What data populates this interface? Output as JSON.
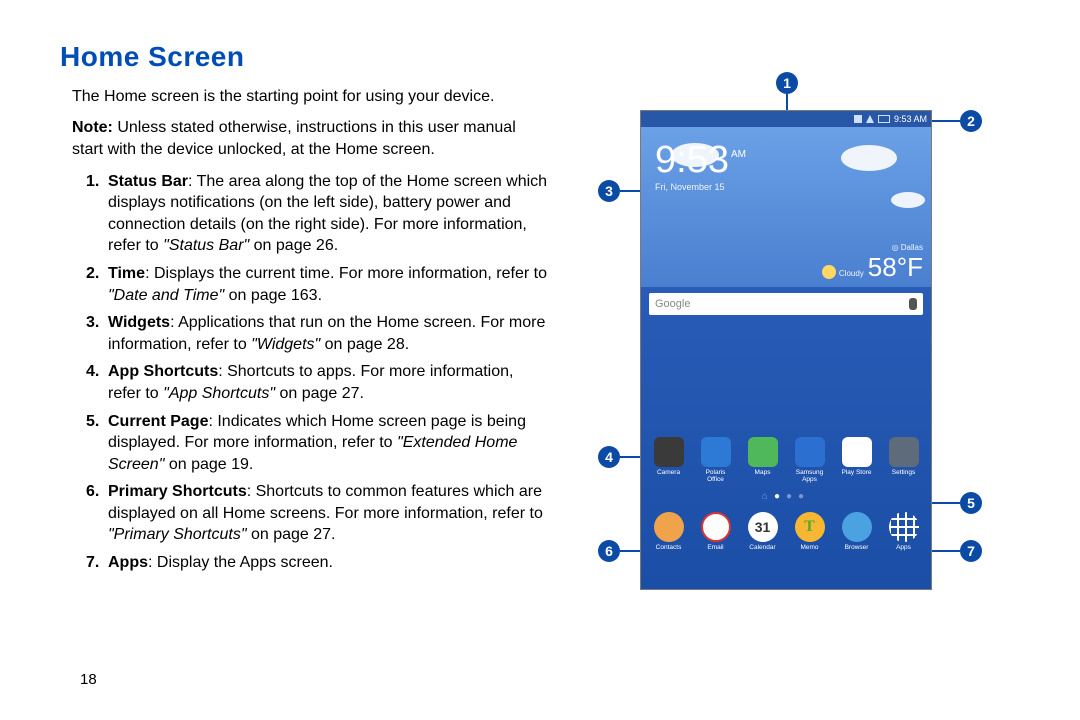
{
  "heading": "Home Screen",
  "intro": "The Home screen is the starting point for using your device.",
  "note_lead": "Note:",
  "note_body": " Unless stated otherwise, instructions in this user manual start with the device unlocked, at the Home screen.",
  "items": [
    {
      "term": "Status Bar",
      "body_a": ": The area along the top of the Home screen which displays notifications (on the left side), battery power and connection details (on the right side). For more information, refer to ",
      "ref": "\"Status Bar\"",
      "body_b": " on page 26."
    },
    {
      "term": "Time",
      "body_a": ": Displays the current time. For more information, refer to ",
      "ref": "\"Date and Time\"",
      "body_b": " on page 163."
    },
    {
      "term": "Widgets",
      "body_a": ": Applications that run on the Home screen. For more information, refer to ",
      "ref": "\"Widgets\"",
      "body_b": " on page 28."
    },
    {
      "term": "App Shortcuts",
      "body_a": ": Shortcuts to apps. For more information, refer to ",
      "ref": "\"App Shortcuts\"",
      "body_b": " on page 27."
    },
    {
      "term": "Current Page",
      "body_a": ": Indicates which Home screen page is being displayed. For more information, refer to ",
      "ref": "\"Extended Home Screen\"",
      "body_b": " on page 19."
    },
    {
      "term": "Primary Shortcuts",
      "body_a": ": Shortcuts to common features which are displayed on all Home screens. For more information, refer to ",
      "ref": "\"Primary Shortcuts\"",
      "body_b": " on page 27."
    },
    {
      "term": "Apps",
      "body_a": ": Display the Apps screen.",
      "ref": "",
      "body_b": ""
    }
  ],
  "page_number": "18",
  "device": {
    "status_time": "9:53 AM",
    "clock_time": "9:53",
    "clock_ampm": "AM",
    "clock_date": "Fri, November 15",
    "weather_loc": "Dallas",
    "weather_cond": "Cloudy",
    "weather_temp": "58°F",
    "search_label": "Google",
    "apps": [
      {
        "label": "Camera",
        "color": "#3a3a3a"
      },
      {
        "label": "Polaris Office",
        "color": "#2d7ad6"
      },
      {
        "label": "Maps",
        "color": "#4fb85a"
      },
      {
        "label": "Samsung Apps",
        "color": "#2b6fd0"
      },
      {
        "label": "Play Store",
        "color": "#ffffff"
      },
      {
        "label": "Settings",
        "color": "#5e6b7a"
      }
    ],
    "primary": [
      {
        "label": "Contacts",
        "color": "#f0a34a"
      },
      {
        "label": "Email",
        "color": "#ffffff"
      },
      {
        "label": "Calendar",
        "color": "#ffffff"
      },
      {
        "label": "Memo",
        "color": "#f7b733"
      },
      {
        "label": "Browser",
        "color": "#4aa3e0"
      },
      {
        "label": "Apps",
        "color": "#ffffff"
      }
    ],
    "cal_num": "31",
    "memo_letter": "T"
  },
  "callouts": [
    "1",
    "2",
    "3",
    "4",
    "5",
    "6",
    "7"
  ]
}
